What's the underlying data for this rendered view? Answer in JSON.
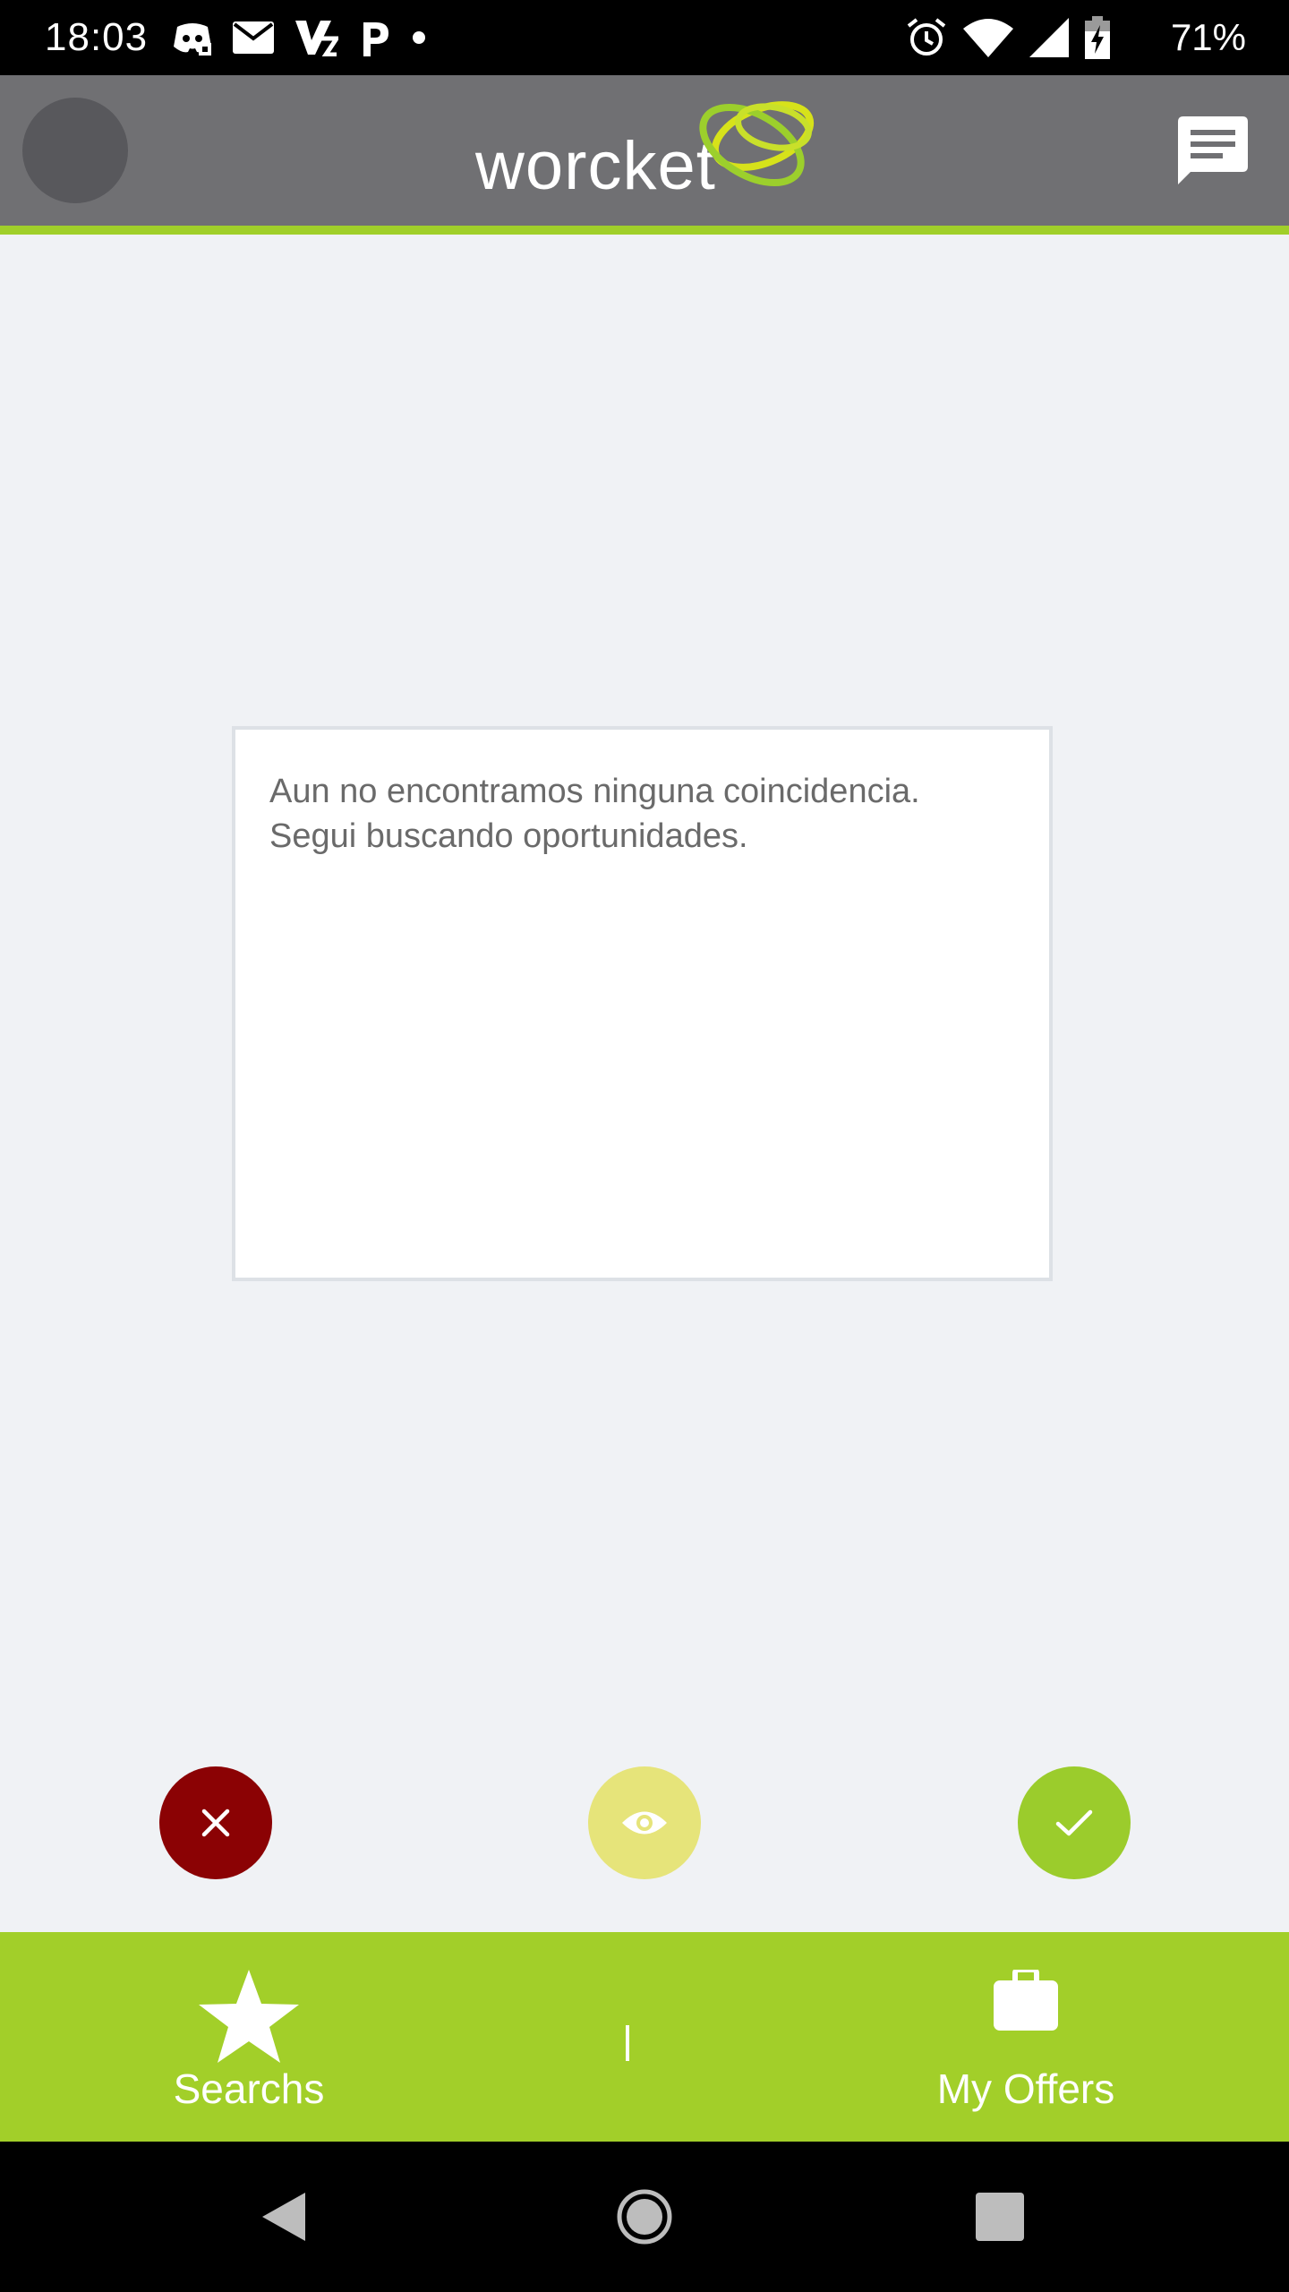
{
  "status_bar": {
    "time": "18:03",
    "battery_percent": "71%",
    "left_icons": [
      "discord-icon",
      "mail-icon",
      "vscode-icon",
      "p-app-icon",
      "dot-icon"
    ],
    "right_icons": [
      "alarm-icon",
      "wifi-icon",
      "signal-icon",
      "battery-charging-icon"
    ]
  },
  "header": {
    "logo_text": "worcket",
    "avatar": "avatar",
    "chat_icon": "chat-icon"
  },
  "card": {
    "line1": "Aun no encontramos ninguna coincidencia.",
    "line2": "Segui buscando oportunidades."
  },
  "actions": {
    "reject_icon": "close-icon",
    "view_icon": "eye-icon",
    "accept_icon": "check-icon"
  },
  "bottom_nav": {
    "items": [
      {
        "label": "Searchs",
        "icon": "star-icon"
      },
      {
        "label": "My Offers",
        "icon": "briefcase-icon"
      }
    ]
  },
  "system_nav": {
    "buttons": [
      "back-icon",
      "home-icon",
      "recents-icon"
    ]
  },
  "colors": {
    "header_bg": "#707073",
    "accent_green": "#a2cf29",
    "reject_red": "#8b0204",
    "view_yellow": "#e6e47a",
    "accept_green": "#9bcc2c",
    "page_bg": "#f0f2f5"
  }
}
